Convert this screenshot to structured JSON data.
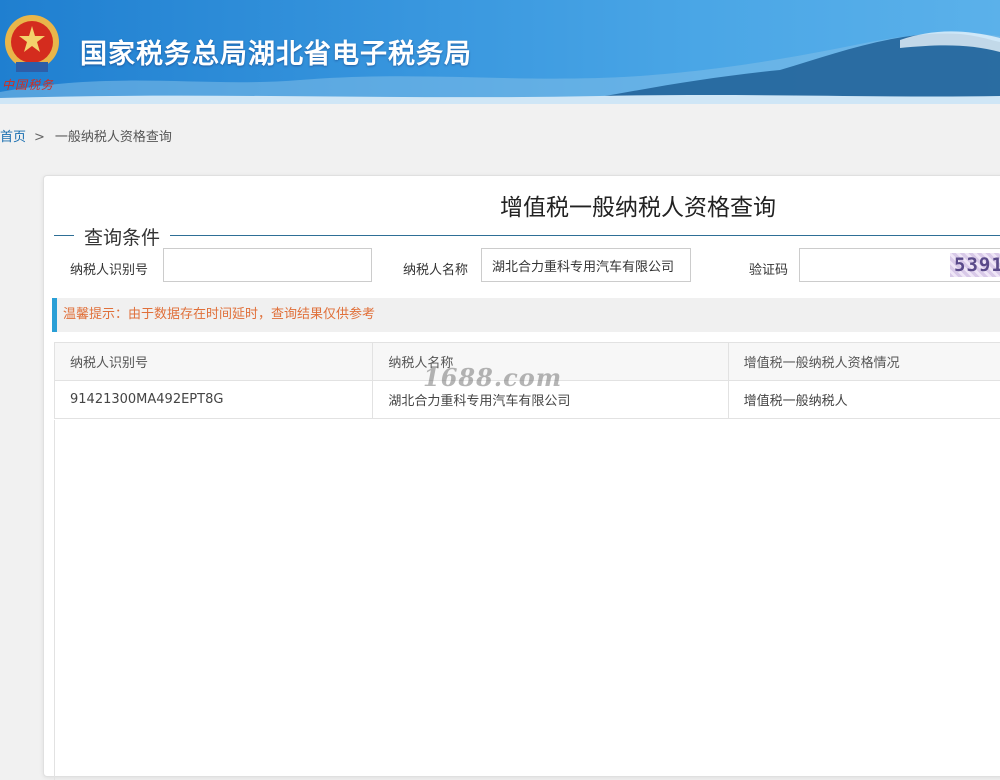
{
  "header": {
    "site_title": "国家税务总局湖北省电子税务局",
    "logo_text": "中国税务"
  },
  "breadcrumb": {
    "home": "首页",
    "separator": ">",
    "current": "一般纳税人资格查询"
  },
  "page": {
    "title": "增值税一般纳税人资格查询",
    "section_title": "查询条件"
  },
  "form": {
    "taxpayer_id_label": "纳税人识别号",
    "taxpayer_id_value": "",
    "taxpayer_name_label": "纳税人名称",
    "taxpayer_name_value": "湖北合力重科专用汽车有限公司",
    "captcha_label": "验证码",
    "captcha_value": "",
    "captcha_image_text": "5391"
  },
  "tip": "温馨提示：由于数据存在时间延时，查询结果仅供参考",
  "table": {
    "headers": [
      "纳税人识别号",
      "纳税人名称",
      "增值税一般纳税人资格情况"
    ],
    "rows": [
      [
        "91421300MA492EPT8G",
        "湖北合力重科专用汽车有限公司",
        "增值税一般纳税人"
      ]
    ]
  },
  "watermark": "1688.com",
  "colors": {
    "banner": "#2a8ad8",
    "tip_text": "#e0703a",
    "tip_accent": "#2a9fd6",
    "link": "#1a6fb0"
  }
}
